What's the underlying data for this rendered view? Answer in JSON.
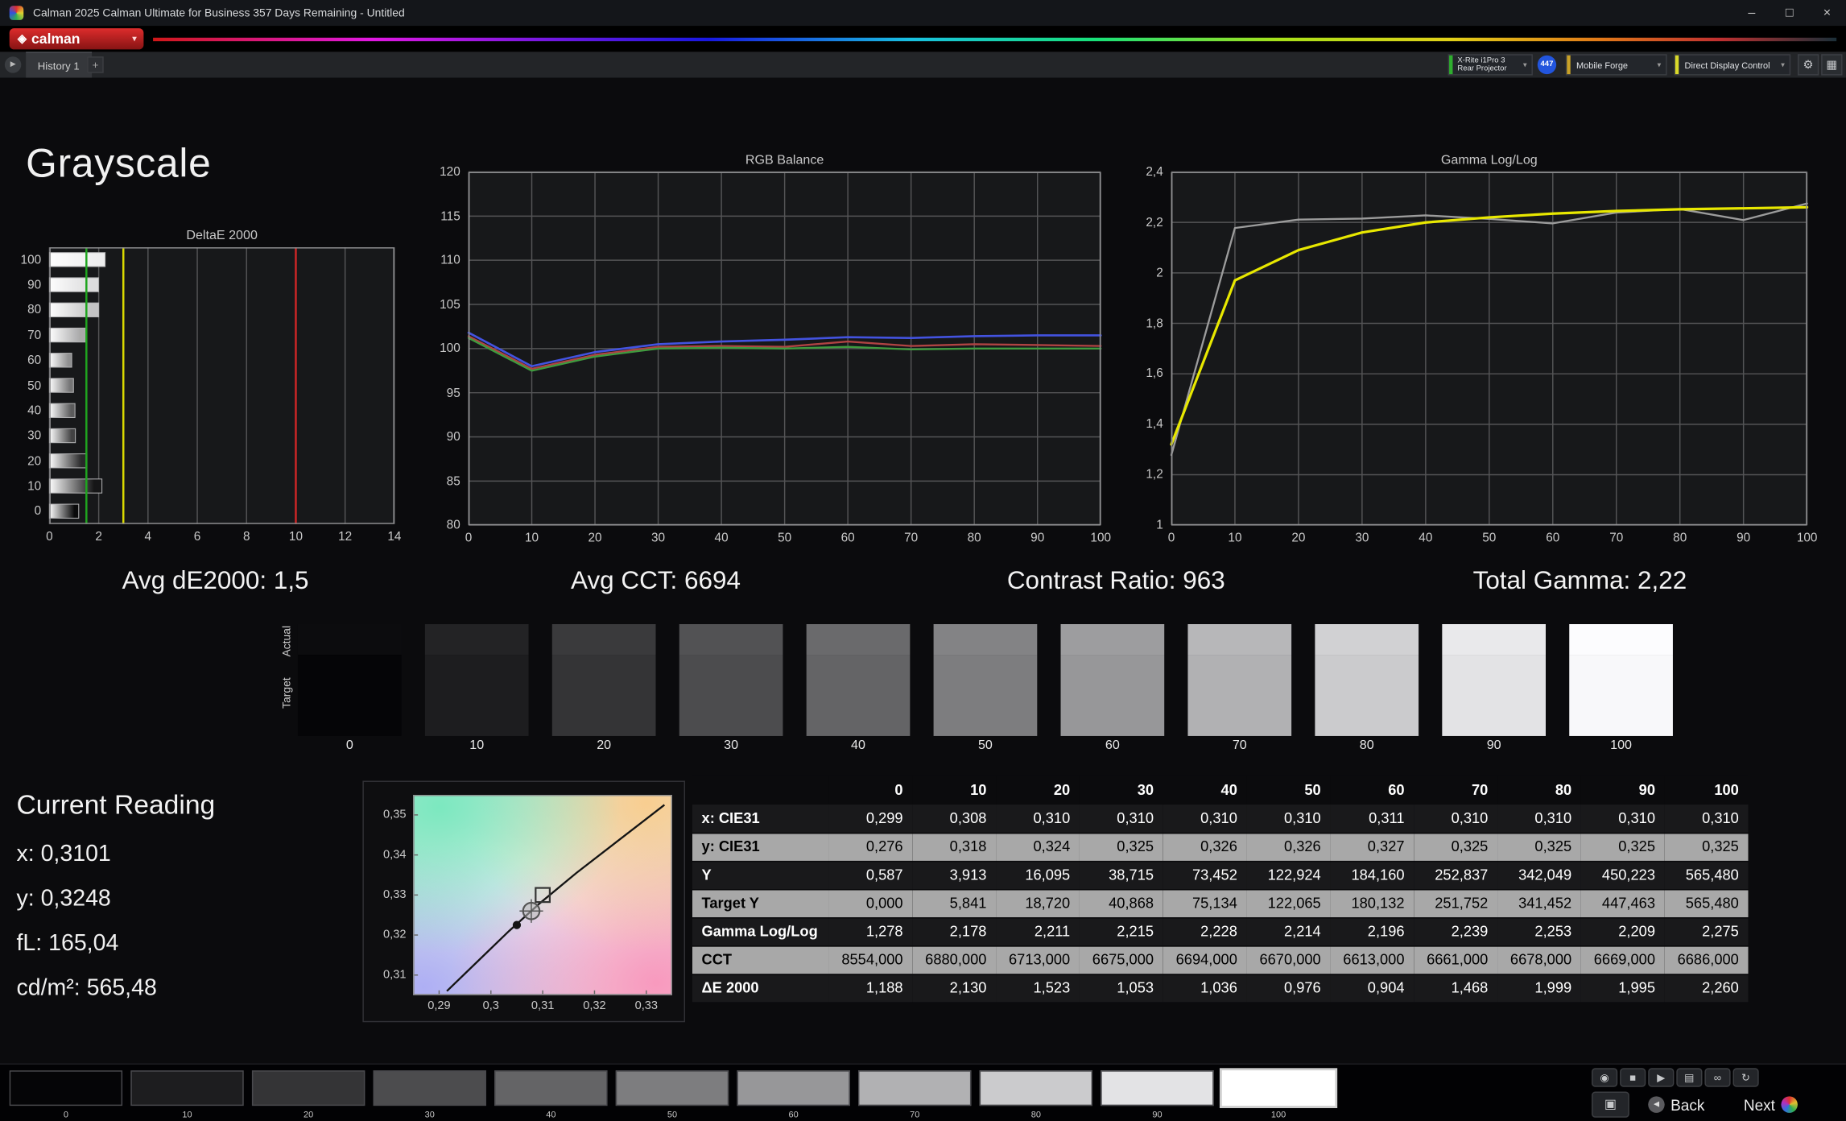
{
  "window": {
    "title": "Calman 2025 Calman Ultimate for Business 357 Days Remaining  - Untitled",
    "controls": {
      "minimize": "–",
      "maximize": "□",
      "close": "×"
    }
  },
  "brand": {
    "logo_mark": "◈",
    "logo_text": "calman"
  },
  "tabbar": {
    "history_tab": "History 1",
    "meter_line1": "X-Rite i1Pro 3",
    "meter_line2": "Rear Projector",
    "badge": "447",
    "source": "Mobile Forge",
    "display_control": "Direct Display Control"
  },
  "page": {
    "title": "Grayscale",
    "stats": [
      "Avg dE2000: 1,5",
      "Avg CCT: 6694",
      "Contrast Ratio: 963",
      "Total Gamma: 2,22"
    ]
  },
  "chart_data": [
    {
      "id": "deltae",
      "type": "bar",
      "title": "DeltaE 2000",
      "xlim": [
        0,
        14
      ],
      "xticks": [
        {
          "v": 0,
          "label": "0"
        },
        {
          "v": 2,
          "label": "2"
        },
        {
          "v": 4,
          "label": "4"
        },
        {
          "v": 6,
          "label": "6"
        },
        {
          "v": 8,
          "label": "8"
        },
        {
          "v": 10,
          "label": "10"
        },
        {
          "v": 12,
          "label": "12"
        },
        {
          "v": 14,
          "label": "14"
        }
      ],
      "bars": [
        {
          "level": "100",
          "value": 2.26,
          "color": "#ededee"
        },
        {
          "level": "90",
          "value": 1.995,
          "color": "#dcdcdd"
        },
        {
          "level": "80",
          "value": 1.999,
          "color": "#c3c3c4"
        },
        {
          "level": "70",
          "value": 1.468,
          "color": "#a9a9aa"
        },
        {
          "level": "60",
          "value": 0.904,
          "color": "#8f8f90"
        },
        {
          "level": "50",
          "value": 0.976,
          "color": "#757576"
        },
        {
          "level": "40",
          "value": 1.036,
          "color": "#5b5b5c"
        },
        {
          "level": "30",
          "value": 1.053,
          "color": "#424243"
        },
        {
          "level": "20",
          "value": 1.523,
          "color": "#29292a"
        },
        {
          "level": "10",
          "value": 2.13,
          "color": "#161617"
        },
        {
          "level": "0",
          "value": 1.188,
          "color": "#0a0a0b"
        }
      ],
      "ref_lines": [
        {
          "v": 1.5,
          "color": "#1fa51f"
        },
        {
          "v": 3,
          "color": "#d9d900"
        },
        {
          "v": 10,
          "color": "#cc2626"
        }
      ]
    },
    {
      "id": "rgb-balance",
      "type": "line",
      "title": "RGB Balance",
      "x": [
        0,
        10,
        20,
        30,
        40,
        50,
        60,
        70,
        80,
        90,
        100
      ],
      "xlim": [
        0,
        100
      ],
      "ylim": [
        80,
        120
      ],
      "xticks": [
        {
          "v": 0,
          "label": "0"
        },
        {
          "v": 10,
          "label": "10"
        },
        {
          "v": 20,
          "label": "20"
        },
        {
          "v": 30,
          "label": "30"
        },
        {
          "v": 40,
          "label": "40"
        },
        {
          "v": 50,
          "label": "50"
        },
        {
          "v": 60,
          "label": "60"
        },
        {
          "v": 70,
          "label": "70"
        },
        {
          "v": 80,
          "label": "80"
        },
        {
          "v": 90,
          "label": "90"
        },
        {
          "v": 100,
          "label": "100"
        }
      ],
      "yticks": [
        {
          "v": 80,
          "label": "80"
        },
        {
          "v": 85,
          "label": "85"
        },
        {
          "v": 90,
          "label": "90"
        },
        {
          "v": 95,
          "label": "95"
        },
        {
          "v": 100,
          "label": "100"
        },
        {
          "v": 105,
          "label": "105"
        },
        {
          "v": 110,
          "label": "110"
        },
        {
          "v": 115,
          "label": "115"
        },
        {
          "v": 120,
          "label": "120"
        }
      ],
      "series": [
        {
          "name": "Red",
          "color": "#b04343",
          "width": 1.6,
          "values": [
            101.4,
            97.7,
            99.3,
            100.2,
            100.3,
            100.2,
            100.8,
            100.3,
            100.5,
            100.4,
            100.3
          ]
        },
        {
          "name": "Green",
          "color": "#3f9b3f",
          "width": 1.6,
          "values": [
            101.2,
            97.5,
            99.1,
            100.0,
            100.1,
            100.0,
            100.2,
            99.9,
            100.0,
            100.0,
            100.0
          ]
        },
        {
          "name": "Blue",
          "color": "#4353e0",
          "width": 1.8,
          "values": [
            101.8,
            98.0,
            99.6,
            100.5,
            100.8,
            101.0,
            101.3,
            101.2,
            101.4,
            101.5,
            101.5
          ]
        }
      ]
    },
    {
      "id": "gamma",
      "type": "line",
      "title": "Gamma Log/Log",
      "x": [
        0,
        10,
        20,
        30,
        40,
        50,
        60,
        70,
        80,
        90,
        100
      ],
      "xlim": [
        0,
        100
      ],
      "ylim": [
        1,
        2.4
      ],
      "xticks": [
        {
          "v": 0,
          "label": "0"
        },
        {
          "v": 10,
          "label": "10"
        },
        {
          "v": 20,
          "label": "20"
        },
        {
          "v": 30,
          "label": "30"
        },
        {
          "v": 40,
          "label": "40"
        },
        {
          "v": 50,
          "label": "50"
        },
        {
          "v": 60,
          "label": "60"
        },
        {
          "v": 70,
          "label": "70"
        },
        {
          "v": 80,
          "label": "80"
        },
        {
          "v": 90,
          "label": "90"
        },
        {
          "v": 100,
          "label": "100"
        }
      ],
      "yticks": [
        {
          "v": 1,
          "label": "1"
        },
        {
          "v": 1.2,
          "label": "1,2"
        },
        {
          "v": 1.4,
          "label": "1,4"
        },
        {
          "v": 1.6,
          "label": "1,6"
        },
        {
          "v": 1.8,
          "label": "1,8"
        },
        {
          "v": 2,
          "label": "2"
        },
        {
          "v": 2.2,
          "label": "2,2"
        },
        {
          "v": 2.4,
          "label": "2,4"
        }
      ],
      "series": [
        {
          "name": "Measured",
          "color": "#9c9c9c",
          "width": 1.6,
          "values": [
            1.278,
            2.178,
            2.211,
            2.215,
            2.228,
            2.214,
            2.196,
            2.239,
            2.253,
            2.209,
            2.275
          ]
        },
        {
          "name": "Target",
          "color": "#e8e800",
          "width": 2.2,
          "values": [
            1.32,
            1.97,
            2.09,
            2.16,
            2.2,
            2.22,
            2.235,
            2.245,
            2.252,
            2.256,
            2.26
          ]
        }
      ]
    }
  ],
  "cie": {
    "xlim": [
      0.285,
      0.335
    ],
    "ylim": [
      0.305,
      0.355
    ],
    "xticks": [
      {
        "v": 0.29,
        "label": "0,29"
      },
      {
        "v": 0.3,
        "label": "0,3"
      },
      {
        "v": 0.31,
        "label": "0,31"
      },
      {
        "v": 0.32,
        "label": "0,32"
      },
      {
        "v": 0.33,
        "label": "0,33"
      }
    ],
    "yticks": [
      {
        "v": 0.31,
        "label": "0,31"
      },
      {
        "v": 0.32,
        "label": "0,32"
      },
      {
        "v": 0.33,
        "label": "0,33"
      },
      {
        "v": 0.34,
        "label": "0,34"
      },
      {
        "v": 0.35,
        "label": "0,35"
      }
    ],
    "locus": [
      [
        0.2915,
        0.306
      ],
      [
        0.2975,
        0.3135
      ],
      [
        0.3035,
        0.321
      ],
      [
        0.3095,
        0.328
      ],
      [
        0.3165,
        0.3355
      ],
      [
        0.3245,
        0.3435
      ],
      [
        0.3335,
        0.3525
      ]
    ],
    "blackbody_point": [
      0.305,
      0.3225
    ],
    "reading_point": [
      0.3078,
      0.326
    ],
    "target_point": [
      0.31,
      0.33
    ]
  },
  "current_reading": {
    "title": "Current Reading",
    "lines": [
      "x: 0,3101",
      "y: 0,3248",
      "fL: 165,04",
      "cd/m²: 565,48"
    ]
  },
  "swatches": {
    "actual_label": "Actual",
    "target_label": "Target",
    "items": [
      {
        "label": "0",
        "actual": "#0c0c0e",
        "target": "#050507"
      },
      {
        "label": "10",
        "actual": "#232325",
        "target": "#1d1d1f"
      },
      {
        "label": "20",
        "actual": "#3a3a3c",
        "target": "#343436"
      },
      {
        "label": "30",
        "actual": "#525254",
        "target": "#4c4c4e"
      },
      {
        "label": "40",
        "actual": "#6a6a6c",
        "target": "#646466"
      },
      {
        "label": "50",
        "actual": "#838385",
        "target": "#7d7d7f"
      },
      {
        "label": "60",
        "actual": "#9d9d9f",
        "target": "#979799"
      },
      {
        "label": "70",
        "actual": "#b7b7b9",
        "target": "#b1b1b3"
      },
      {
        "label": "80",
        "actual": "#d1d1d3",
        "target": "#cbcbcd"
      },
      {
        "label": "90",
        "actual": "#e9e9eb",
        "target": "#e3e3e5"
      },
      {
        "label": "100",
        "actual": "#fcfcfe",
        "target": "#f8f8fa"
      }
    ]
  },
  "table": {
    "columns": [
      "0",
      "10",
      "20",
      "30",
      "40",
      "50",
      "60",
      "70",
      "80",
      "90",
      "100"
    ],
    "rows": [
      {
        "label": "x: CIE31",
        "values": [
          "0,299",
          "0,308",
          "0,310",
          "0,310",
          "0,310",
          "0,310",
          "0,311",
          "0,310",
          "0,310",
          "0,310",
          "0,310"
        ]
      },
      {
        "label": "y: CIE31",
        "values": [
          "0,276",
          "0,318",
          "0,324",
          "0,325",
          "0,326",
          "0,326",
          "0,327",
          "0,325",
          "0,325",
          "0,325",
          "0,325"
        ]
      },
      {
        "label": "Y",
        "values": [
          "0,587",
          "3,913",
          "16,095",
          "38,715",
          "73,452",
          "122,924",
          "184,160",
          "252,837",
          "342,049",
          "450,223",
          "565,480"
        ]
      },
      {
        "label": "Target Y",
        "values": [
          "0,000",
          "5,841",
          "18,720",
          "40,868",
          "75,134",
          "122,065",
          "180,132",
          "251,752",
          "341,452",
          "447,463",
          "565,480"
        ]
      },
      {
        "label": "Gamma Log/Log",
        "values": [
          "1,278",
          "2,178",
          "2,211",
          "2,215",
          "2,228",
          "2,214",
          "2,196",
          "2,239",
          "2,253",
          "2,209",
          "2,275"
        ]
      },
      {
        "label": "CCT",
        "values": [
          "8554,000",
          "6880,000",
          "6713,000",
          "6675,000",
          "6694,000",
          "6670,000",
          "6613,000",
          "6661,000",
          "6678,000",
          "6669,000",
          "6686,000"
        ]
      },
      {
        "label": "ΔE 2000",
        "values": [
          "1,188",
          "2,130",
          "1,523",
          "1,053",
          "1,036",
          "0,976",
          "0,904",
          "1,468",
          "1,999",
          "1,995",
          "2,260"
        ]
      }
    ]
  },
  "bottom_bar": {
    "levels": [
      {
        "label": "0",
        "color": "#050507"
      },
      {
        "label": "10",
        "color": "#1d1d1f"
      },
      {
        "label": "20",
        "color": "#343436"
      },
      {
        "label": "30",
        "color": "#4c4c4e"
      },
      {
        "label": "40",
        "color": "#646466"
      },
      {
        "label": "50",
        "color": "#7d7d7f"
      },
      {
        "label": "60",
        "color": "#979799"
      },
      {
        "label": "70",
        "color": "#b1b1b3"
      },
      {
        "label": "80",
        "color": "#cbcbcd"
      },
      {
        "label": "90",
        "color": "#e3e3e5"
      },
      {
        "label": "100",
        "color": "#ffffff",
        "selected": true
      }
    ],
    "tools": [
      "◉",
      "■",
      "▶",
      "▤",
      "∞",
      "↻"
    ],
    "layout_icon": "▣",
    "back": "Back",
    "next": "Next"
  }
}
